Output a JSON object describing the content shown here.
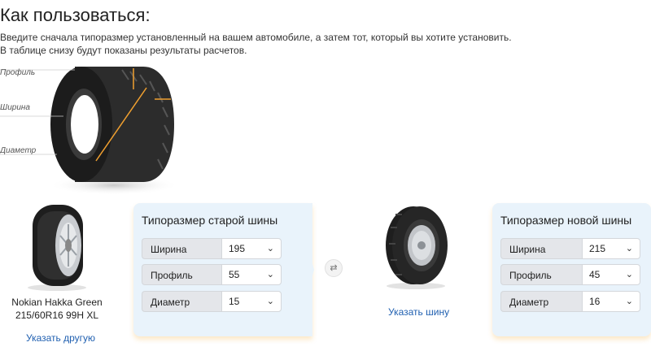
{
  "header": {
    "title": "Как пользоваться:",
    "line1": "Введите сначала типоразмер установленный на вашем автомобиле, а затем тот, который вы хотите установить.",
    "line2": "В таблице снизу будут показаны результаты расчетов."
  },
  "anatomy": {
    "profile_label": "Профиль",
    "width_label": "Ширина",
    "diameter_label": "Диаметр"
  },
  "old_tire": {
    "name_line1": "Nokian Hakka Green",
    "name_line2": "215/60R16 99H XL",
    "link": "Указать другую"
  },
  "old_card": {
    "title": "Типоразмер старой шины",
    "rows": [
      {
        "label": "Ширина",
        "value": "195"
      },
      {
        "label": "Профиль",
        "value": "55"
      },
      {
        "label": "Диаметр",
        "value": "15"
      }
    ]
  },
  "new_tire": {
    "link": "Указать шину"
  },
  "new_card": {
    "title": "Типоразмер новой шины",
    "rows": [
      {
        "label": "Ширина",
        "value": "215"
      },
      {
        "label": "Профиль",
        "value": "45"
      },
      {
        "label": "Диаметр",
        "value": "16"
      }
    ]
  },
  "icons": {
    "chevron": "⌄",
    "swap": "⇄"
  },
  "colors": {
    "card_bg": "#e9f3fb",
    "link": "#1f5fb0",
    "dimension_arrow": "#f0a030"
  }
}
